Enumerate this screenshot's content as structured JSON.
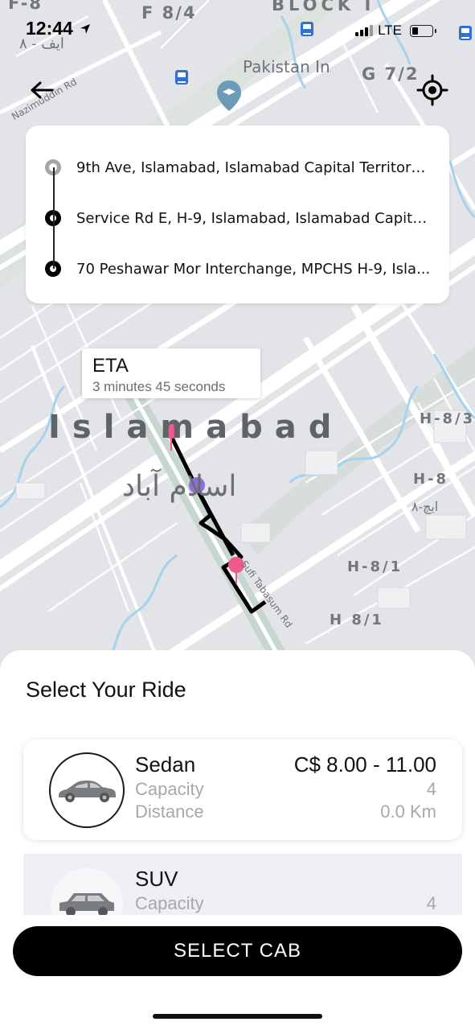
{
  "status_bar": {
    "time": "12:44",
    "network": "LTE",
    "icons": [
      "location-arrow-icon",
      "signal-icon",
      "battery-icon"
    ]
  },
  "map": {
    "labels": {
      "sector_f8": "F-8",
      "sector_f84": "F 8/4",
      "block": "BLOCK I",
      "sector_g72": "G 7/2",
      "poi": "Pakistan Institute of Medical Sci...",
      "road_uddin": "Nazimuddin Rd",
      "city": "Islamabad",
      "city_urdu": "اسلام آباد",
      "sector_h83": "H-8/3",
      "sector_h8": "H-8",
      "sector_h8_urdu": "ایچ-۸",
      "sector_h81a": "H-8/1",
      "sector_h81b": "H 8/1",
      "road_sufi": "Sufi Tabasum Rd",
      "f8_urdu": "ایف - ۸"
    },
    "route_color": "#000000",
    "pin_color": "#ec5b8c",
    "car_pin_color": "#8e6fd8"
  },
  "route_card": {
    "stops": [
      {
        "type": "origin",
        "address": "9th Ave, Islamabad, Islamabad Capital Territory,..."
      },
      {
        "type": "stop",
        "address": "Service Rd E, H-9, Islamabad, Islamabad Capital..."
      },
      {
        "type": "destination",
        "address": "70 Peshawar Mor Interchange, MPCHS H-9, Isla..."
      }
    ]
  },
  "eta": {
    "title": "ETA",
    "value": "3 minutes 45 seconds"
  },
  "sheet": {
    "title": "Select Your Ride",
    "rides": [
      {
        "name": "Sedan",
        "price": "C$ 8.00 - 11.00",
        "capacity_label": "Capacity",
        "capacity": "4",
        "distance_label": "Distance",
        "distance": "0.0 Km",
        "icon": "sedan-car-icon",
        "selected": true
      },
      {
        "name": "SUV",
        "capacity_label": "Capacity",
        "capacity": "4",
        "icon": "suv-car-icon",
        "selected": false
      }
    ],
    "button": "SELECT CAB"
  },
  "colors": {
    "accent": "#000000",
    "sheet_bg": "#ffffff",
    "muted_text": "#a8a8a8"
  }
}
